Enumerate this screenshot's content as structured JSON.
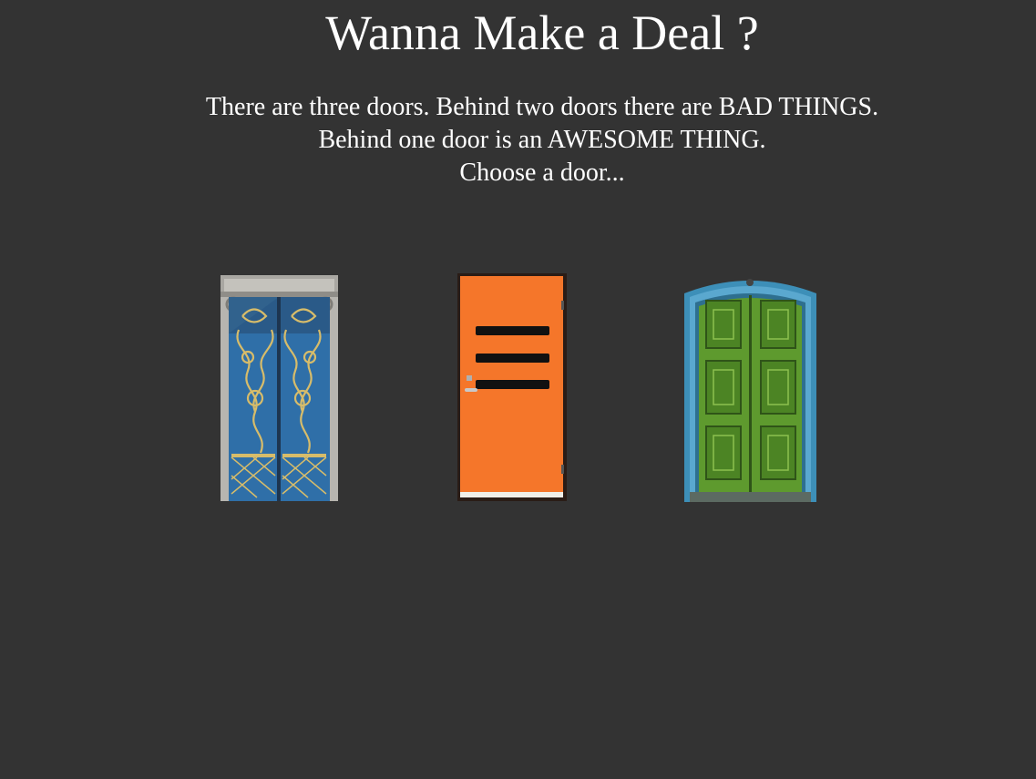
{
  "page": {
    "title": "Wanna Make a Deal ?",
    "intro_lines": [
      "There are three doors. Behind two doors there are BAD THINGS.",
      "Behind one door is an AWESOME THING.",
      "Choose a door..."
    ]
  },
  "doors": [
    {
      "color": "#2f6fa8",
      "icon": "ornate-blue-door"
    },
    {
      "color": "#f5762a",
      "icon": "orange-door"
    },
    {
      "color": "#5e9a2e",
      "icon": "green-door"
    }
  ],
  "colors": {
    "background": "#333333",
    "text": "#ffffff"
  }
}
